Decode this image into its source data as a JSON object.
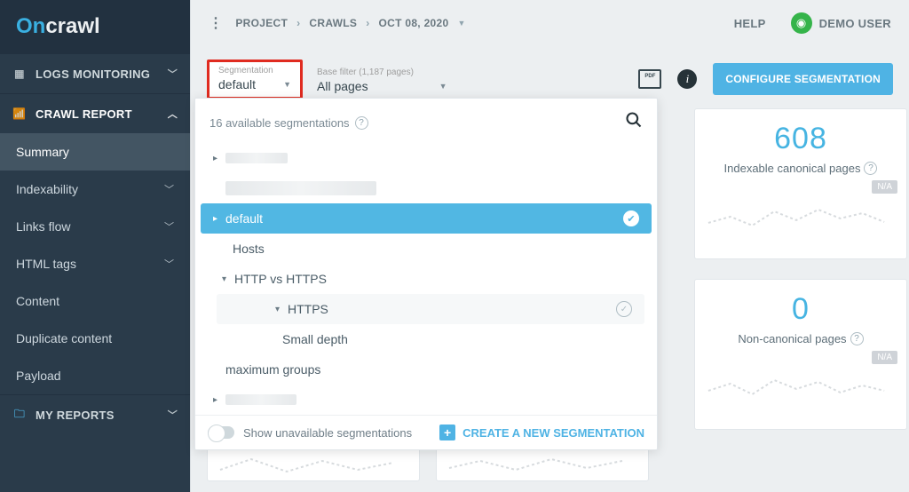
{
  "logo": {
    "part1": "On",
    "part2": "crawl"
  },
  "breadcrumbs": {
    "project": "PROJECT",
    "crawls": "CRAWLS",
    "date": "OCT 08, 2020"
  },
  "header": {
    "help": "HELP",
    "user": "DEMO USER"
  },
  "sidebar": {
    "logs_monitoring": "LOGS MONITORING",
    "crawl_report": "CRAWL REPORT",
    "items": [
      "Summary",
      "Indexability",
      "Links flow",
      "HTML tags",
      "Content",
      "Duplicate content",
      "Payload"
    ],
    "my_reports": "MY REPORTS"
  },
  "filters": {
    "segmentation_label": "Segmentation",
    "segmentation_value": "default",
    "base_filter_label": "Base filter (1,187 pages)",
    "base_filter_value": "All pages"
  },
  "button": {
    "configure": "CONFIGURE SEGMENTATION"
  },
  "segmentation_panel": {
    "count_label": "16 available segmentations",
    "items": {
      "default": "default",
      "hosts": "Hosts",
      "http_vs_https": "HTTP vs HTTPS",
      "https": "HTTPS",
      "small_depth": "Small depth",
      "maximum_groups": "maximum groups"
    },
    "footer_toggle_label": "Show unavailable segmentations",
    "create_link": "CREATE A NEW SEGMENTATION"
  },
  "cards": {
    "indexable": {
      "value": "608",
      "title": "Indexable canonical pages",
      "badge": "N/A"
    },
    "noncanonical": {
      "value": "0",
      "title": "Non-canonical pages",
      "badge": "N/A"
    }
  }
}
